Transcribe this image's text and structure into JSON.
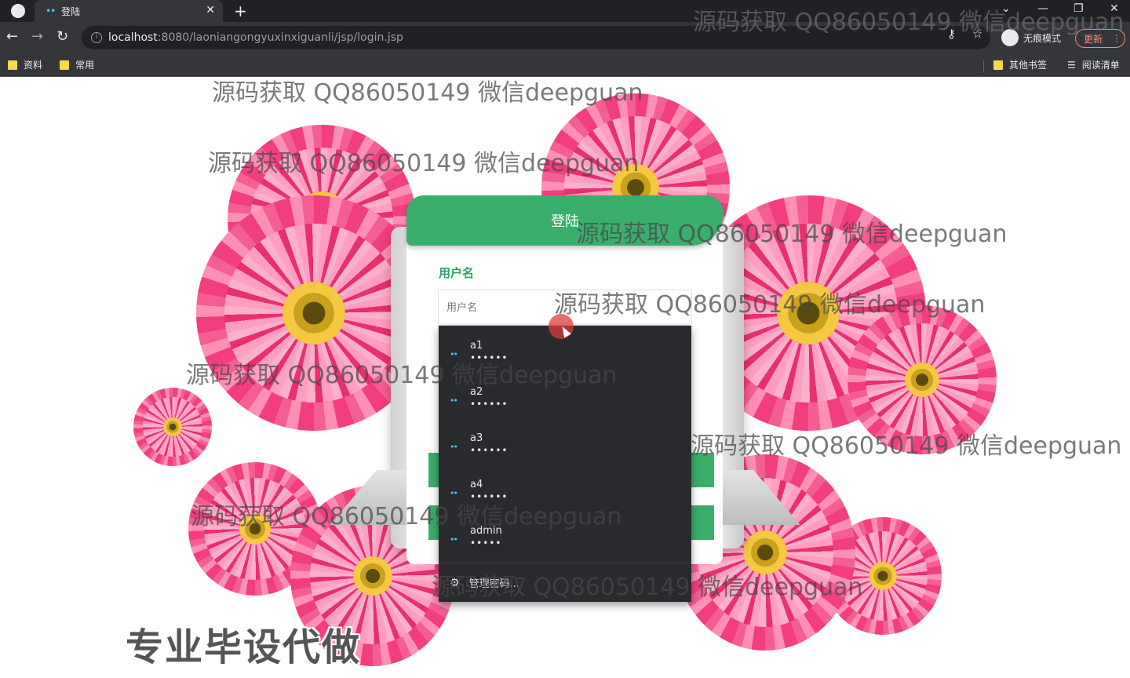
{
  "browser": {
    "tab_title": "登陆",
    "url_host": "localhost",
    "url_path": ":8080/laoniangongyuxinxiguanli/jsp/login.jsp",
    "incognito_label": "无痕模式",
    "update_label": "更新",
    "bookmarks": [
      "资料",
      "常用"
    ],
    "other_bookmarks": "其他书签",
    "reading_list": "阅读清单"
  },
  "login": {
    "header_title": "登陆",
    "username_label": "用户名",
    "username_placeholder": "用户名"
  },
  "autocomplete": {
    "items": [
      {
        "user": "a1",
        "password": "••••••"
      },
      {
        "user": "a2",
        "password": "••••••"
      },
      {
        "user": "a3",
        "password": "••••••"
      },
      {
        "user": "a4",
        "password": "••••••"
      },
      {
        "user": "admin",
        "password": "•••••"
      }
    ],
    "manage_label": "管理密码..."
  },
  "watermark_text": "源码获取 QQ86050149 微信deepguan",
  "ad_text": "专业毕设代做",
  "colors": {
    "accent_green": "#3aae6b",
    "flower_pink": "#f23d7f"
  }
}
